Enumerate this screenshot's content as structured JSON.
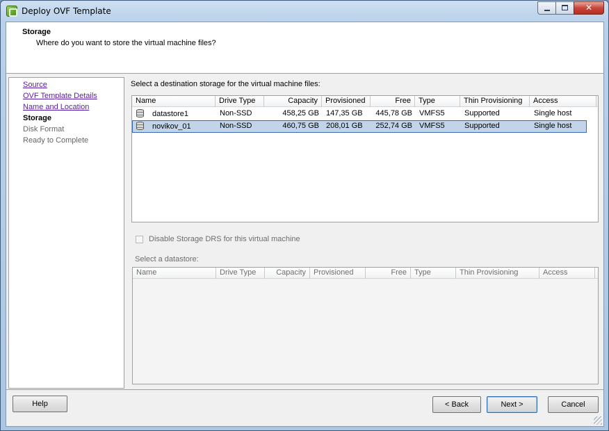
{
  "window": {
    "title": "Deploy OVF Template",
    "minimize": "minimize",
    "maximize": "maximize",
    "close": "✕"
  },
  "header": {
    "title": "Storage",
    "subtitle": "Where do you want to store the virtual machine files?"
  },
  "steps": [
    {
      "label": "Source",
      "state": "link"
    },
    {
      "label": "OVF Template Details",
      "state": "link"
    },
    {
      "label": "Name and Location",
      "state": "link"
    },
    {
      "label": "Storage",
      "state": "current"
    },
    {
      "label": "Disk Format",
      "state": "pending"
    },
    {
      "label": "Ready to Complete",
      "state": "pending"
    }
  ],
  "storage": {
    "label": "Select a destination storage for the virtual machine files:",
    "columns": [
      "Name",
      "Drive Type",
      "Capacity",
      "Provisioned",
      "Free",
      "Type",
      "Thin Provisioning",
      "Access"
    ],
    "rows": [
      {
        "name": "datastore1",
        "drive_type": "Non-SSD",
        "capacity": "458,25 GB",
        "provisioned": "147,35 GB",
        "free": "445,78 GB",
        "type": "VMFS5",
        "thin": "Supported",
        "access": "Single host",
        "selected": false
      },
      {
        "name": "novikov_01",
        "drive_type": "Non-SSD",
        "capacity": "460,75 GB",
        "provisioned": "208,01 GB",
        "free": "252,74 GB",
        "type": "VMFS5",
        "thin": "Supported",
        "access": "Single host",
        "selected": true
      }
    ]
  },
  "drs": {
    "label": "Disable Storage DRS for this virtual machine",
    "checked": false,
    "enabled": false
  },
  "datastore": {
    "label": "Select a datastore:",
    "columns": [
      "Name",
      "Drive Type",
      "Capacity",
      "Provisioned",
      "Free",
      "Type",
      "Thin Provisioning",
      "Access"
    ]
  },
  "buttons": {
    "help": "Help",
    "back": "< Back",
    "next": "Next >",
    "cancel": "Cancel"
  }
}
